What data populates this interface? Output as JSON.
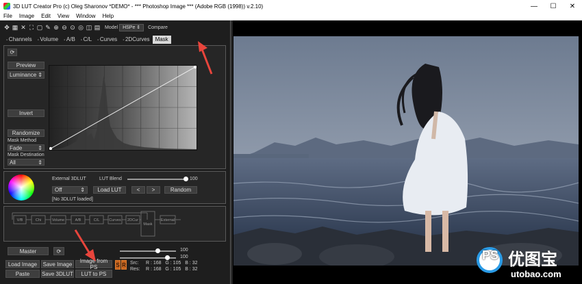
{
  "window": {
    "title": "3D LUT Creator Pro (c) Oleg Sharonov *DEMO* - *** Photoshop Image *** (Adobe RGB (1998)) v.2.10)",
    "controls": [
      "—",
      "☐",
      "✕"
    ]
  },
  "menu": [
    "File",
    "Image",
    "Edit",
    "View",
    "Window",
    "Help"
  ],
  "toolbar": {
    "model_label": "Model",
    "model_value": "HSPe",
    "compare_label": "Compare"
  },
  "tabs": [
    "Channels",
    "Volume",
    "A/B",
    "C/L",
    "Curves",
    "2DCurves",
    "Mask"
  ],
  "mask_panel": {
    "preview": "Preview",
    "luminance": "Luminance",
    "invert": "Invert",
    "randomize": "Randomize",
    "mask_method_label": "Mask Method",
    "mask_method_value": "Fade",
    "mask_destination_label": "Mask Destination",
    "mask_destination_value": "All"
  },
  "external": {
    "label": "External 3DLUT",
    "blend_label": "LUT Blend",
    "blend_value": "100",
    "off": "Off",
    "load_lut": "Load LUT",
    "prev": "<",
    "next": ">",
    "random": "Random",
    "status": "[No 3DLUT loaded]"
  },
  "pipeline": [
    "V/B",
    "Chi",
    "Volume",
    "A/B",
    "C/L",
    "Curves",
    "2DCur",
    "Mask",
    "External"
  ],
  "master": {
    "label": "Master",
    "value1": "100",
    "value2": "100"
  },
  "bottom": {
    "load_image": "Load Image",
    "save_image": "Save Image",
    "image_from_ps": "Image from PS",
    "paste": "Paste",
    "save_3dlut": "Save 3DLUT",
    "lut_to_ps": "LUT to PS",
    "s": "S",
    "r": "R",
    "src_label": "Src:",
    "res_label": "Res:",
    "src_values": "R : 168   G : 105   B : 32",
    "res_values": "R : 168   G : 105   B : 32"
  },
  "watermark": {
    "left": "PS",
    "right": "优图宝",
    "url": "utobao.com"
  },
  "colors": {
    "accent": "#e8453c",
    "panel_bg": "#262626",
    "sky": "#7a889c",
    "sea": "#3c4a62"
  }
}
